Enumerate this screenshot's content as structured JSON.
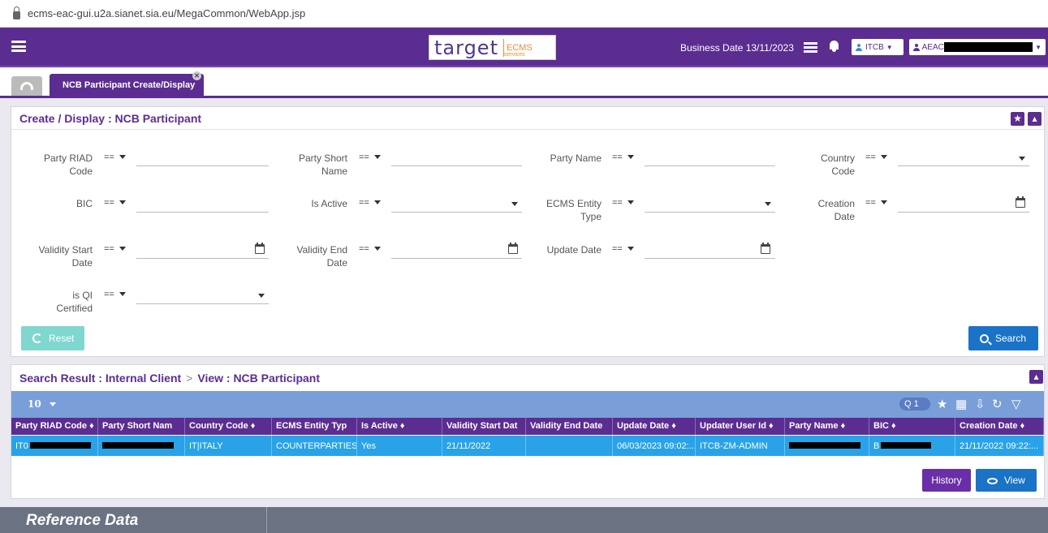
{
  "browser": {
    "url": "ecms-eac-gui.u2a.sianet.sia.eu/MegaCommon/WebApp.jsp"
  },
  "header": {
    "logo_text": "target",
    "logo_sub": "services",
    "logo_ecms": "ECMS",
    "business_date": "Business Date 13/11/2023",
    "role": "ITCB",
    "user_prefix": "AEAC"
  },
  "tabs": [
    {
      "label": "NCB Participant Create/Display"
    }
  ],
  "form": {
    "title": "Create / Display : NCB Participant",
    "operator": "==",
    "fields": {
      "party_riad_code": "Party RIAD Code",
      "party_short_name": "Party Short Name",
      "party_name": "Party Name",
      "country_code": "Country Code",
      "bic": "BIC",
      "is_active": "Is Active",
      "ecms_entity_type": "ECMS Entity Type",
      "creation_date": "Creation Date",
      "validity_start_date": "Validity Start Date",
      "validity_end_date": "Validity End Date",
      "update_date": "Update Date",
      "is_qi_certified": "is QI Certified"
    },
    "reset_label": "Reset",
    "search_label": "Search"
  },
  "results": {
    "breadcrumb_1": "Search Result : Internal Client",
    "breadcrumb_sep": ">",
    "breadcrumb_2": "View : NCB Participant",
    "page_size": "10",
    "query_count": "1",
    "columns": [
      "Party RIAD Code ♦",
      "Party Short Nam",
      "Country Code ♦",
      "ECMS Entity Typ",
      "Is Active ♦",
      "Validity Start Dat",
      "Validity End Date",
      "Update Date ♦",
      "Updater User Id ♦",
      "Party Name ♦",
      "BIC ♦",
      "Creation Date ♦"
    ],
    "rows": [
      [
        "IT0",
        "",
        "IT|ITALY",
        "COUNTERPARTIES",
        "Yes",
        "21/11/2022",
        "",
        "06/03/2023 09:02:...",
        "ITCB-ZM-ADMIN",
        "",
        "B",
        "21/11/2022 09:22:..."
      ]
    ],
    "history_label": "History",
    "view_label": "View"
  },
  "footer": {
    "title": "Reference Data"
  },
  "colors": {
    "brand_purple": "#5b2d91",
    "accent_blue": "#1a73c7",
    "row_selected": "#2aa2e8",
    "reset_teal": "#7fd7cf"
  }
}
